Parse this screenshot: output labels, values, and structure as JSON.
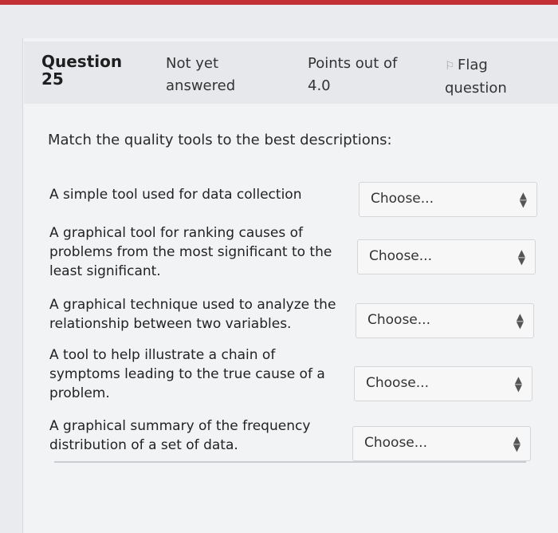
{
  "question": {
    "label": "Question",
    "number": "25",
    "status_line1": "Not yet",
    "status_line2": "answered",
    "points_line1": "Points out of",
    "points_line2": "4.0",
    "flag_line1": "Flag",
    "flag_line2": "question",
    "flag_icon": "flag-icon"
  },
  "prompt": "Match the quality tools to the best descriptions:",
  "items": [
    {
      "description": "A simple tool used for data collection",
      "select_value": "Choose..."
    },
    {
      "description": "A graphical tool for ranking causes of problems from the most significant to the least significant.",
      "select_value": "Choose..."
    },
    {
      "description": "A graphical technique used to analyze the relationship between two variables.",
      "select_value": "Choose..."
    },
    {
      "description": "A tool to help illustrate a chain of symptoms leading to the true cause of a problem.",
      "select_value": "Choose..."
    },
    {
      "description": "A graphical summary of the frequency distribution of a set of data.",
      "select_value": "Choose..."
    }
  ],
  "colors": {
    "topbar": "#c23035",
    "background": "#e9ebee"
  }
}
